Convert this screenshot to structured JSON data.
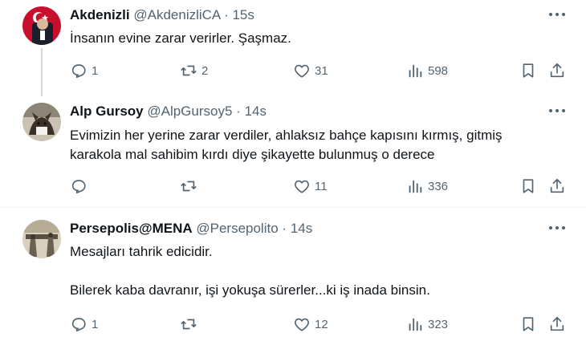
{
  "colors": {
    "text": "#0f1419",
    "secondary": "#536471",
    "line": "#cfd9de"
  },
  "tweets": [
    {
      "name": "Akdenizli",
      "handle": "@AkdenizliCA",
      "dot": "·",
      "time": "15s",
      "lines": [
        "İnsanın evine zarar verirler. Şaşmaz."
      ],
      "reply_count": "1",
      "retweet_count": "2",
      "like_count": "31",
      "view_count": "598"
    },
    {
      "name": "Alp Gursoy",
      "handle": "@AlpGursoy5",
      "dot": "·",
      "time": "14s",
      "lines": [
        "Evimizin her yerine zarar verdiler, ahlaksız bahçe kapısını kırmış, gitmiş",
        "karakola mal sahibim kırdı diye şikayette bulunmuş o derece"
      ],
      "reply_count": "",
      "retweet_count": "",
      "like_count": "11",
      "view_count": "336"
    },
    {
      "name": "Persepolis@MENA",
      "handle": "@Persepolito",
      "dot": "·",
      "time": "14s",
      "lines": [
        "Mesajları tahrik  edicidir.",
        "",
        "Bilerek kaba davranır, işi yokuşa sürerler...ki iş inada binsin."
      ],
      "reply_count": "1",
      "retweet_count": "",
      "like_count": "12",
      "view_count": "323"
    }
  ]
}
